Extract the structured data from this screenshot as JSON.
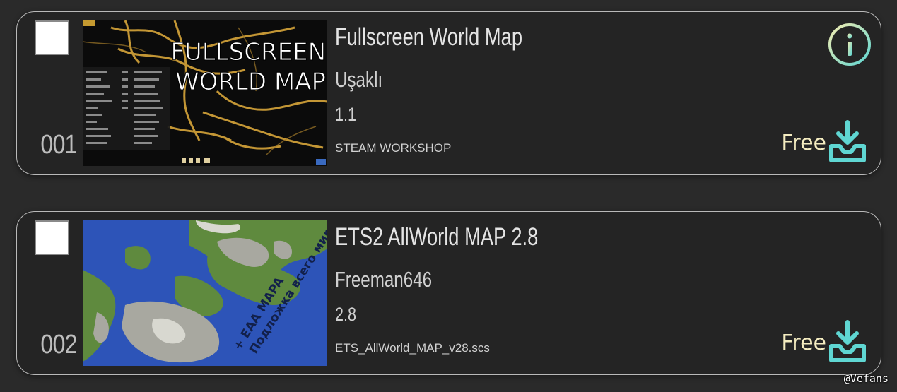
{
  "colors": {
    "page_bg": "#2a2a2a",
    "card_bg": "#242424",
    "card_border": "#b9b9b9",
    "accent_teal": "#5fd6d2",
    "free_text": "#f4ecc0"
  },
  "items": [
    {
      "index": "001",
      "title": "Fullscreen World Map",
      "author": "Uşaklı",
      "version": "1.1",
      "source": "STEAM WORKSHOP",
      "thumbnail_text_line1": "FULLSCREEN",
      "thumbnail_text_line2": "WORLD MAP",
      "info_icon": "info-circle-icon",
      "price": "Free",
      "download_icon": "download-tray-icon"
    },
    {
      "index": "002",
      "title": "ETS2 AllWorld MAP 2.8",
      "author": "Freeman646",
      "version": "2.8",
      "source": "ETS_AllWorld_MAP_v28.scs",
      "thumbnail_text_line1": "Подложка всего мира",
      "thumbnail_text_line2": "+ EAA MAPA",
      "price": "Free",
      "download_icon": "download-tray-icon"
    }
  ],
  "watermark": "@Vefans"
}
